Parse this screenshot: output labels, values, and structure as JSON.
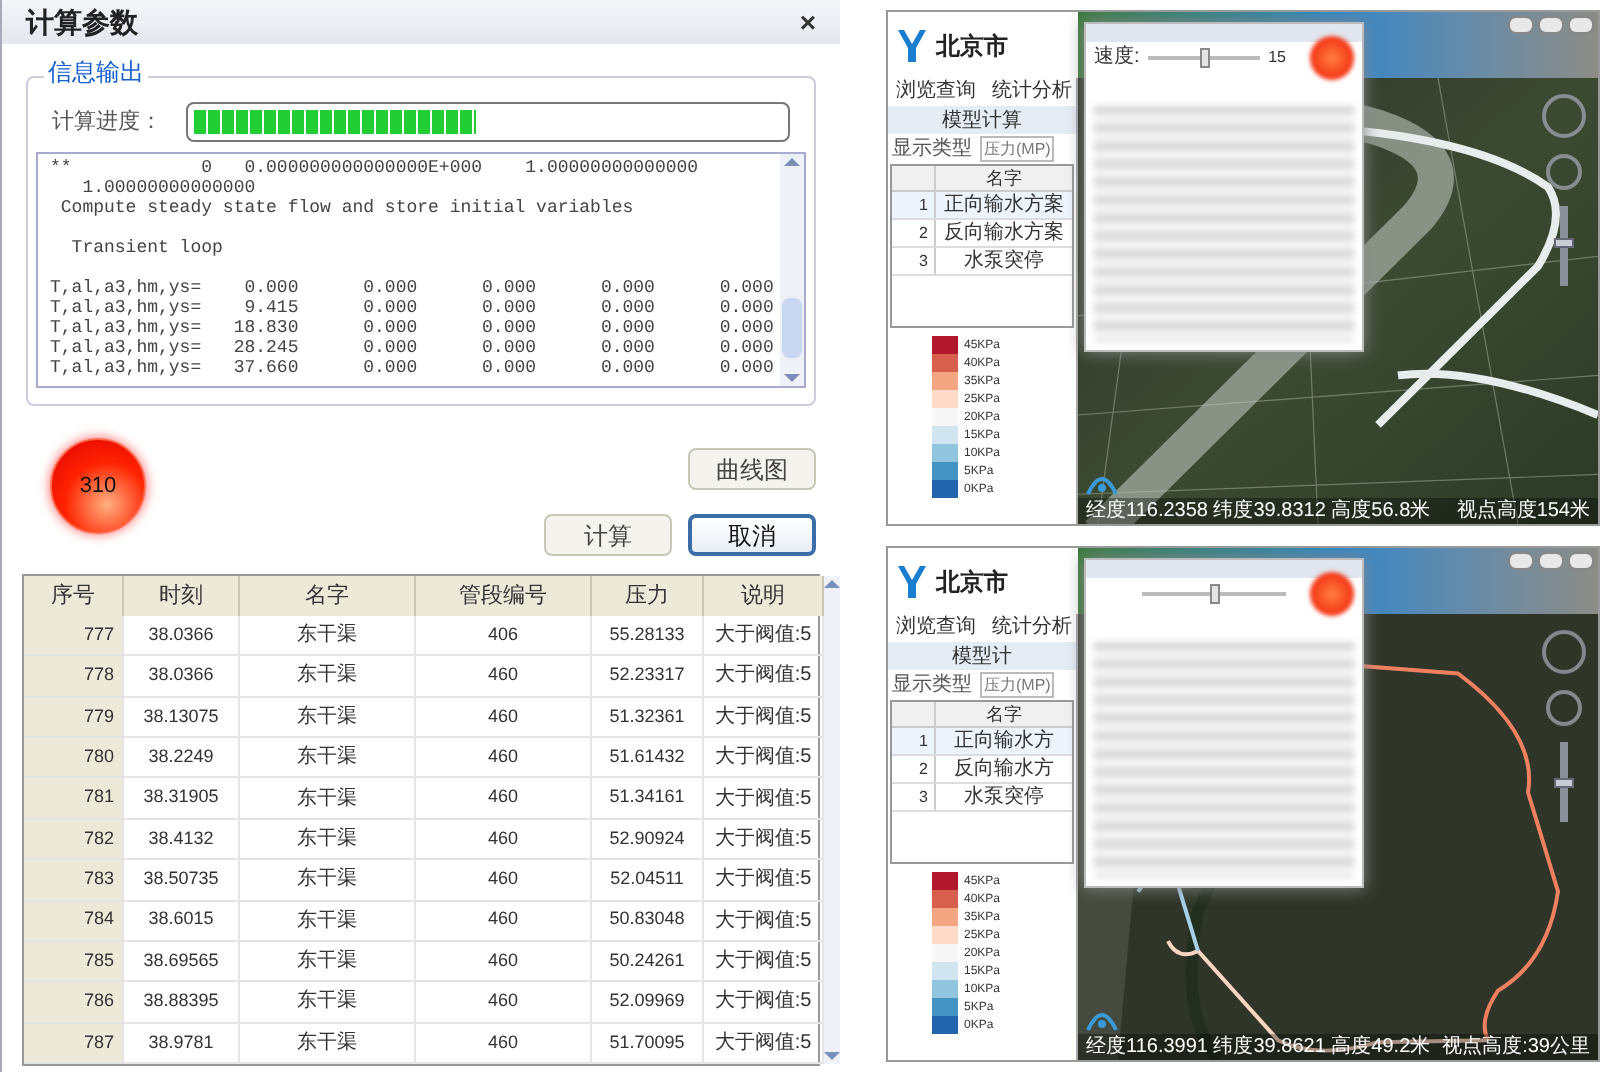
{
  "dialog": {
    "title": "计算参数",
    "close": "×",
    "group_title": "信息输出",
    "progress_label": "计算进度：",
    "progress": {
      "level": 0.48
    },
    "log_blocks": [
      [
        "**            0   0.000000000000000E+000    1.00000000000000",
        "   1.00000000000000",
        " Compute steady state flow and store initial variables"
      ],
      [
        "  Transient loop"
      ],
      [
        "T,al,a3,hm,ys=    0.000      0.000      0.000      0.000      0.000",
        "T,al,a3,hm,ys=    9.415      0.000      0.000      0.000      0.000",
        "T,al,a3,hm,ys=   18.830      0.000      0.000      0.000      0.000",
        "T,al,a3,hm,ys=   28.245      0.000      0.000      0.000      0.000",
        "T,al,a3,hm,ys=   37.660      0.000      0.000      0.000      0.000"
      ]
    ],
    "indicator": "310",
    "buttons": [
      {
        "label": "曲线图",
        "default": false
      },
      {
        "label": "计算",
        "default": false
      },
      {
        "label": "取消",
        "default": true
      }
    ],
    "table": {
      "columns": [
        "序号",
        "时刻",
        "名字",
        "管段编号",
        "压力",
        "说明"
      ],
      "rows": [
        [
          "777",
          "38.0366",
          "东干渠",
          "406",
          "55.28133",
          "大于阀值:5"
        ],
        [
          "778",
          "38.0366",
          "东干渠",
          "460",
          "52.23317",
          "大于阀值:5"
        ],
        [
          "779",
          "38.13075",
          "东干渠",
          "460",
          "51.32361",
          "大于阀值:5"
        ],
        [
          "780",
          "38.2249",
          "东干渠",
          "460",
          "51.61432",
          "大于阀值:5"
        ],
        [
          "781",
          "38.31905",
          "东干渠",
          "460",
          "51.34161",
          "大于阀值:5"
        ],
        [
          "782",
          "38.4132",
          "东干渠",
          "460",
          "52.90924",
          "大于阀值:5"
        ],
        [
          "783",
          "38.50735",
          "东干渠",
          "460",
          "52.04511",
          "大于阀值:5"
        ],
        [
          "784",
          "38.6015",
          "东干渠",
          "460",
          "50.83048",
          "大于阀值:5"
        ],
        [
          "785",
          "38.69565",
          "东干渠",
          "460",
          "50.24261",
          "大于阀值:5"
        ],
        [
          "786",
          "38.88395",
          "东干渠",
          "460",
          "52.09969",
          "大于阀值:5"
        ],
        [
          "787",
          "38.9781",
          "东干渠",
          "460",
          "51.70095",
          "大于阀值:5"
        ]
      ]
    }
  },
  "map_views": [
    {
      "kind": "terrain",
      "app_title": "北京市",
      "menu": [
        "浏览查询",
        "统计分析"
      ],
      "panel_title": "模型计算",
      "display_type_label": "显示类型",
      "display_type_value": "压力(MP)",
      "list_column": "名字",
      "list_rows": [
        {
          "index": "1",
          "name": "正向输水方案",
          "selected": true
        },
        {
          "index": "2",
          "name": "反向输水方案",
          "selected": false
        },
        {
          "index": "3",
          "name": "水泵突停",
          "selected": false
        }
      ],
      "legend": [
        {
          "label": "45KPa",
          "color": "#b2182b"
        },
        {
          "label": "40KPa",
          "color": "#d6604d"
        },
        {
          "label": "35KPa",
          "color": "#f4a582"
        },
        {
          "label": "25KPa",
          "color": "#fddbc7"
        },
        {
          "label": "20KPa",
          "color": "#f7f7f7"
        },
        {
          "label": "15KPa",
          "color": "#d1e5f0"
        },
        {
          "label": "10KPa",
          "color": "#92c5de"
        },
        {
          "label": "5KPa",
          "color": "#4393c3"
        },
        {
          "label": "0KPa",
          "color": "#2166ac"
        }
      ],
      "overlay": {
        "speed_label": "速度:",
        "speed_value": "15",
        "speed": {
          "level": 0.5
        }
      },
      "zoom": {
        "level": 0.55
      },
      "status_left": "经度116.2358 纬度39.8312 高度56.8米",
      "status_right": "视点高度154米"
    },
    {
      "kind": "plan",
      "app_title": "北京市",
      "menu": [
        "浏览查询",
        "统计分析"
      ],
      "panel_title": "模型计",
      "display_type_label": "显示类型",
      "display_type_value": "压力(MP)",
      "list_column": "名字",
      "list_rows": [
        {
          "index": "1",
          "name": "正向输水方",
          "selected": true
        },
        {
          "index": "2",
          "name": "反向输水方",
          "selected": false
        },
        {
          "index": "3",
          "name": "水泵突停",
          "selected": false
        }
      ],
      "legend": [
        {
          "label": "45KPa",
          "color": "#b2182b"
        },
        {
          "label": "40KPa",
          "color": "#d6604d"
        },
        {
          "label": "35KPa",
          "color": "#f4a582"
        },
        {
          "label": "25KPa",
          "color": "#fddbc7"
        },
        {
          "label": "20KPa",
          "color": "#f7f7f7"
        },
        {
          "label": "15KPa",
          "color": "#d1e5f0"
        },
        {
          "label": "10KPa",
          "color": "#92c5de"
        },
        {
          "label": "5KPa",
          "color": "#4393c3"
        },
        {
          "label": "0KPa",
          "color": "#2166ac"
        }
      ],
      "overlay": {
        "speed": {
          "level": 0.5
        }
      },
      "zoom": {
        "level": 0.5
      },
      "status_left": "经度116.3991 纬度39.8621 高度49.2米",
      "status_right": "视点高度:39公里"
    }
  ]
}
